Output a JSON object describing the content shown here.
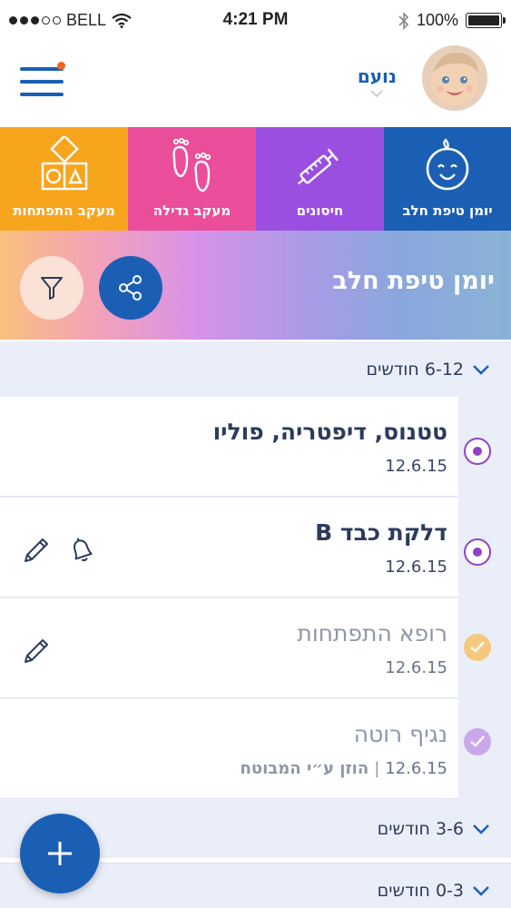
{
  "status_bar": {
    "carrier": "BELL",
    "time": "4:21 PM",
    "battery": "100%"
  },
  "header": {
    "user_name": "נועם"
  },
  "tabs": [
    {
      "label": "מעקב התפתחות",
      "icon": "blocks-icon",
      "color": "#f8a51e"
    },
    {
      "label": "מעקב גדילה",
      "icon": "footprints-icon",
      "color": "#ea4e9a"
    },
    {
      "label": "חיסונים",
      "icon": "syringe-icon",
      "color": "#9b4fe0"
    },
    {
      "label": "יומן טיפת חלב",
      "icon": "baby-face-icon",
      "color": "#1b5fb5",
      "active": true
    }
  ],
  "banner": {
    "title": "יומן טיפת חלב"
  },
  "sections": [
    {
      "title": "6-12 חודשים",
      "items": [
        {
          "title": "טטנוס, דיפטריה, פוליו",
          "date": "12.6.15",
          "status": "open"
        },
        {
          "title": "דלקת כבד B",
          "date": "12.6.15",
          "status": "open",
          "actions": [
            "edit-icon",
            "bell-icon"
          ]
        },
        {
          "title": "רופא התפתחות",
          "date": "12.6.15",
          "status": "done",
          "actions": [
            "edit-icon"
          ]
        },
        {
          "title": "נגיף רוטה",
          "date": "12.6.15",
          "note": "הוזן ע״י המבוטח",
          "status": "done"
        }
      ]
    },
    {
      "title": "3-6 חודשים"
    },
    {
      "title": "0-3 חודשים"
    }
  ],
  "colors": {
    "primary": "#1b5fb5",
    "open_status": "#8e44c9",
    "done_yellow": "#f5c97d",
    "done_purple": "#c9a7ea"
  }
}
